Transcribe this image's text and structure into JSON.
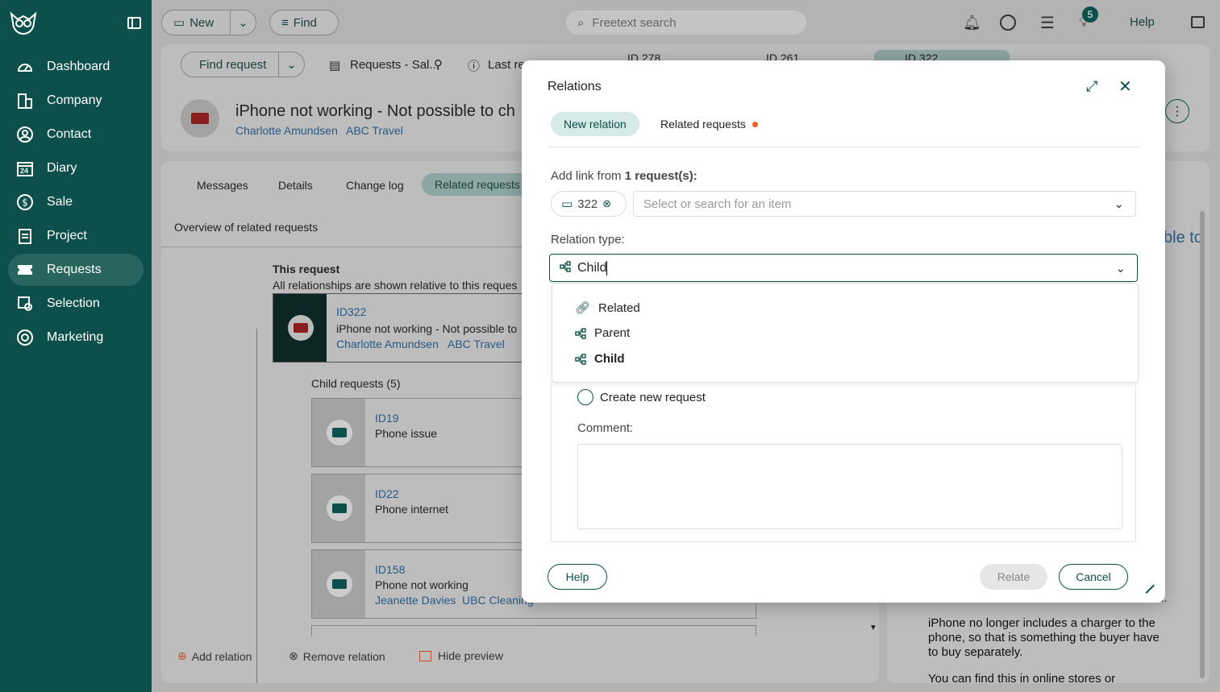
{
  "sidebar": {
    "items": [
      {
        "label": "Dashboard",
        "icon": "dashboard-icon"
      },
      {
        "label": "Company",
        "icon": "company-icon"
      },
      {
        "label": "Contact",
        "icon": "contact-icon"
      },
      {
        "label": "Diary",
        "icon": "diary-icon"
      },
      {
        "label": "Sale",
        "icon": "sale-icon"
      },
      {
        "label": "Project",
        "icon": "project-icon"
      },
      {
        "label": "Requests",
        "icon": "requests-icon"
      },
      {
        "label": "Selection",
        "icon": "selection-icon"
      },
      {
        "label": "Marketing",
        "icon": "marketing-icon"
      }
    ],
    "diary_day": "24"
  },
  "topbar": {
    "new_label": "New",
    "find_label": "Find",
    "search_placeholder": "Freetext search",
    "notif_badge": "5",
    "help_label": "Help"
  },
  "header": {
    "find_request_label": "Find request",
    "breadcrumb_label": "Requests - Sal...",
    "last_label": "Last re",
    "tabs": [
      "ID 278",
      "ID 261",
      "ID 322"
    ],
    "title": "iPhone not working - Not possible to ch",
    "contact_name": "Charlotte Amundsen",
    "company_name": "ABC Travel"
  },
  "content": {
    "tabs": [
      "Messages",
      "Details",
      "Change log",
      "Related requests"
    ],
    "overview_title": "Overview of related requests",
    "this_request": "This request",
    "relationship_note": "All relationships are shown relative to this reques",
    "main_card": {
      "id": "ID322",
      "title": "iPhone not working - Not possible to",
      "contact": "Charlotte Amundsen",
      "company": "ABC Travel"
    },
    "child_header": "Child requests (5)",
    "children": [
      {
        "id": "ID19",
        "title": "Phone issue",
        "contact": "",
        "company": ""
      },
      {
        "id": "ID22",
        "title": "Phone internet",
        "contact": "",
        "company": ""
      },
      {
        "id": "ID158",
        "title": "Phone not working",
        "contact": "Jeanette Davies",
        "company": "UBC Cleaning"
      }
    ],
    "footer": {
      "add": "Add relation",
      "remove": "Remove relation",
      "hide": "Hide preview"
    },
    "preview_title_fragment": "ble to",
    "preview_ellipsis": "...",
    "preview_text_1": "iPhone no longer includes a charger to the phone, so that is something the buyer have to buy separately.",
    "preview_text_2": "You can find this in online stores or"
  },
  "modal": {
    "title": "Relations",
    "tab_new": "New relation",
    "tab_related": "Related requests",
    "add_link_prefix": "Add link from ",
    "add_link_count": "1 request(s):",
    "chip_label": "322",
    "select_placeholder": "Select or search for an item",
    "relation_type_label": "Relation type:",
    "relation_value": "Child",
    "options": [
      "Related",
      "Parent",
      "Child"
    ],
    "create_new_label": "Create new request",
    "comment_label": "Comment:",
    "help_btn": "Help",
    "relate_btn": "Relate",
    "cancel_btn": "Cancel"
  },
  "colors": {
    "sidebar": "#0d4f4a",
    "accent": "#0d4f4a",
    "pill_bg": "#d6ebe8",
    "dot": "#e8642c"
  }
}
